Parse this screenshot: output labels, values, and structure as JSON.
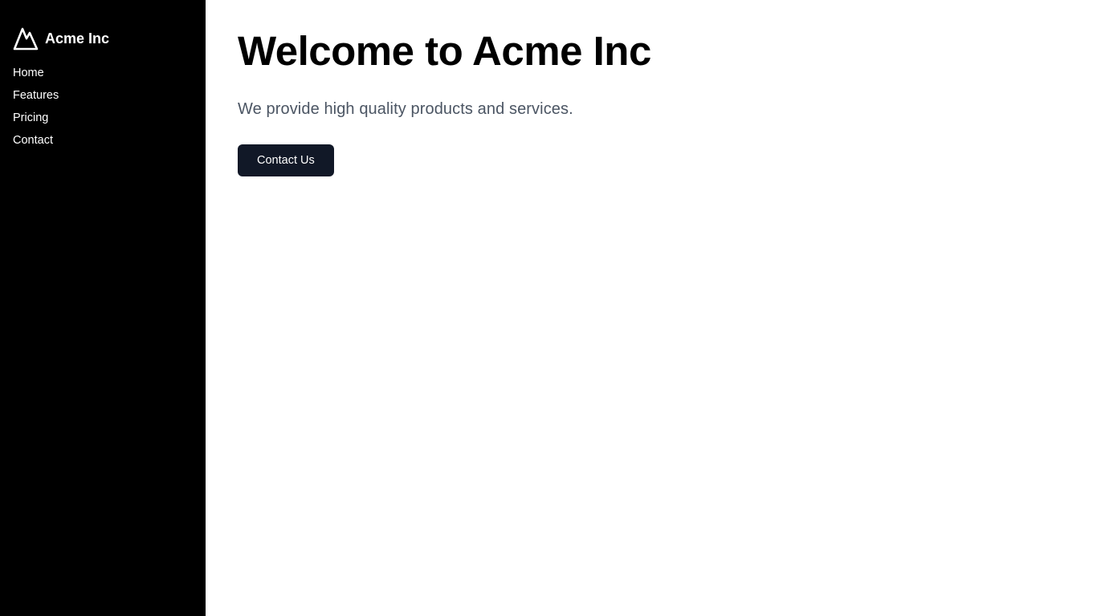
{
  "sidebar": {
    "brand": {
      "icon": "mountain-icon",
      "name": "Acme Inc"
    },
    "nav_items": [
      {
        "label": "Home"
      },
      {
        "label": "Features"
      },
      {
        "label": "Pricing"
      },
      {
        "label": "Contact"
      }
    ]
  },
  "main": {
    "title": "Welcome to Acme Inc",
    "subtitle": "We provide high quality products and services.",
    "cta_label": "Contact Us"
  },
  "colors": {
    "sidebar_background": "#000000",
    "page_background": "#ffffff",
    "title_text": "#000000",
    "subtitle_text": "#4b5563",
    "button_background": "#111827",
    "button_text": "#ffffff"
  }
}
